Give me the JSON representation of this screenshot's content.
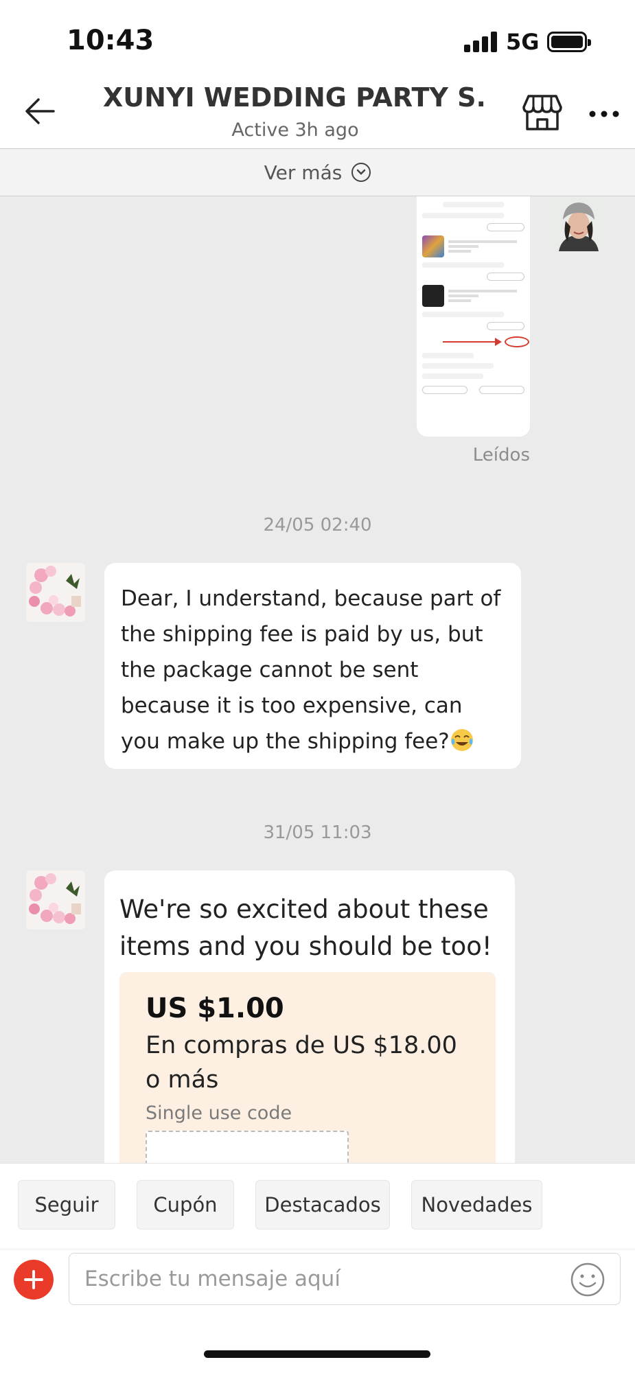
{
  "status_bar": {
    "time": "10:43",
    "network": "5G"
  },
  "header": {
    "title": "XUNYI WEDDING PARTY S...",
    "subtitle": "Active 3h ago"
  },
  "ver_mas": {
    "label": "Ver más"
  },
  "messages": {
    "read_status": "Leídos",
    "timestamp_1": "24/05 02:40",
    "message_1": "Dear, I understand, because part of the shipping fee is paid by us, but the package cannot be sent because it is too expensive, can you make up the shipping fee?",
    "timestamp_2": "31/05 11:03",
    "message_2": "We're so excited about these items and you should be too!",
    "coupon": {
      "amount": "US $1.00",
      "condition": "En compras de US $18.00 o más",
      "note": "Single use code"
    }
  },
  "quick_actions": [
    "Seguir",
    "Cupón",
    "Destacados",
    "Novedades"
  ],
  "composer": {
    "placeholder": "Escribe tu mensaje aquí"
  },
  "colors": {
    "accent": "#ea3b2a",
    "coupon_bg": "#fdf0e2",
    "chat_bg": "#ebebeb"
  },
  "icons": [
    "back-arrow-icon",
    "store-icon",
    "more-icon",
    "chevron-down-icon",
    "plus-icon",
    "emoji-icon"
  ]
}
